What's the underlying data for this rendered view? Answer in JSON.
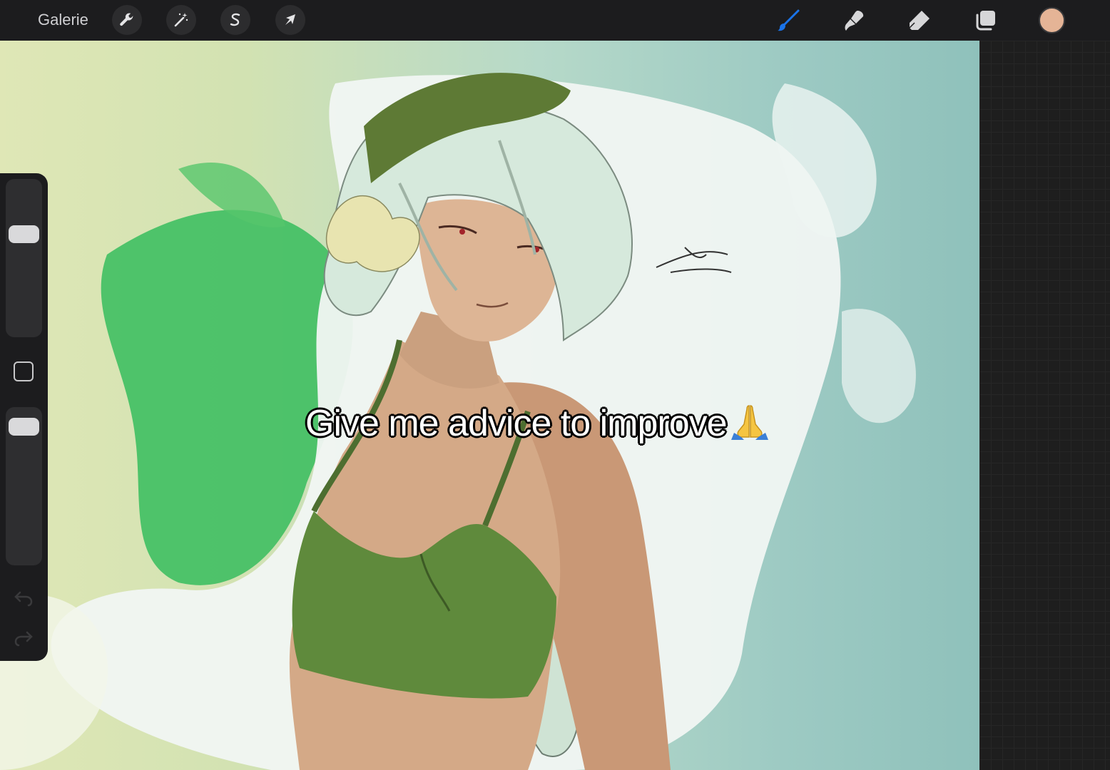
{
  "toolbar": {
    "gallery_label": "Galerie",
    "left_tools": [
      "wrench-icon",
      "magic-wand-icon",
      "selection-s-icon",
      "transform-arrow-icon"
    ],
    "right_tools": [
      "brush-icon",
      "smudge-icon",
      "eraser-icon",
      "layers-icon"
    ],
    "active_tool": "brush-icon",
    "accent_color": "#1a73e8",
    "current_color": "#e5b496"
  },
  "sidebar": {
    "size_slider_level": 0.68,
    "opacity_slider_level": 0.95,
    "modify_button": "square-modify-icon",
    "undo_icon": "undo-icon",
    "redo_icon": "redo-icon"
  },
  "canvas": {
    "caption": "Give me advice to improve",
    "caption_emoji": "praying-hands-icon"
  }
}
